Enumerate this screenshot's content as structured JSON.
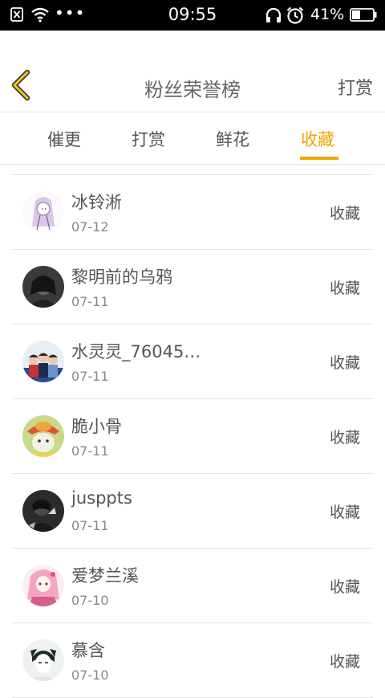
{
  "status_bar": {
    "time": "09:55",
    "dots": "•••",
    "battery_percent": "41%",
    "battery_level": 0.41
  },
  "header": {
    "title": "粉丝荣誉榜",
    "right_action": "打赏"
  },
  "tabs": [
    {
      "label": "催更",
      "active": false
    },
    {
      "label": "打赏",
      "active": false
    },
    {
      "label": "鲜花",
      "active": false
    },
    {
      "label": "收藏",
      "active": true
    }
  ],
  "colors": {
    "accent": "#f0a500",
    "text": "#555555",
    "divider": "#e4e4e4"
  },
  "fans": [
    {
      "name": "冰铃淅",
      "date": "07-12",
      "action": "收藏"
    },
    {
      "name": "黎明前的乌鸦",
      "date": "07-11",
      "action": "收藏"
    },
    {
      "name": "水灵灵_76045…",
      "date": "07-11",
      "action": "收藏"
    },
    {
      "name": "脆小骨",
      "date": "07-11",
      "action": "收藏"
    },
    {
      "name": "jusppts",
      "date": "07-11",
      "action": "收藏"
    },
    {
      "name": "爱梦兰溪",
      "date": "07-10",
      "action": "收藏"
    },
    {
      "name": "慕含",
      "date": "07-10",
      "action": "收藏"
    }
  ]
}
